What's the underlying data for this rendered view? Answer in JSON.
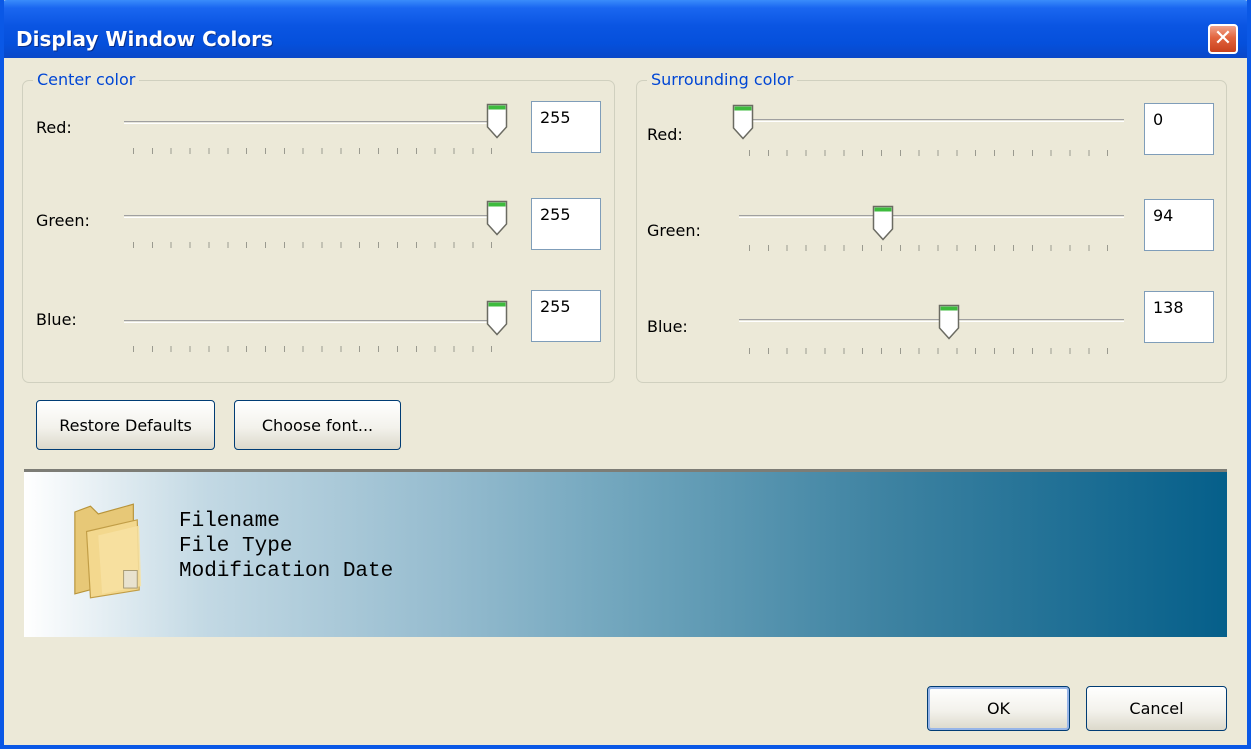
{
  "window": {
    "title": "Display Window Colors"
  },
  "center": {
    "legend": "Center color",
    "channels": [
      {
        "label": "Red:",
        "value": "255",
        "level": 255
      },
      {
        "label": "Green:",
        "value": "255",
        "level": 255
      },
      {
        "label": "Blue:",
        "value": "255",
        "level": 255
      }
    ]
  },
  "surrounding": {
    "legend": "Surrounding color",
    "channels": [
      {
        "label": "Red:",
        "value": "0",
        "level": 0
      },
      {
        "label": "Green:",
        "value": "94",
        "level": 94
      },
      {
        "label": "Blue:",
        "value": "138",
        "level": 138
      }
    ]
  },
  "buttons": {
    "restore_defaults": "Restore Defaults",
    "choose_font": "Choose font...",
    "ok": "OK",
    "cancel": "Cancel"
  },
  "preview": {
    "icon": "folder-icon",
    "lines": [
      "Filename",
      "File Type",
      "Modification Date"
    ]
  },
  "colors": {
    "title_bar": "#0a55e2",
    "legend_text": "#0046d5",
    "center_color": "#ffffff",
    "surrounding_color": "#005e8a"
  }
}
